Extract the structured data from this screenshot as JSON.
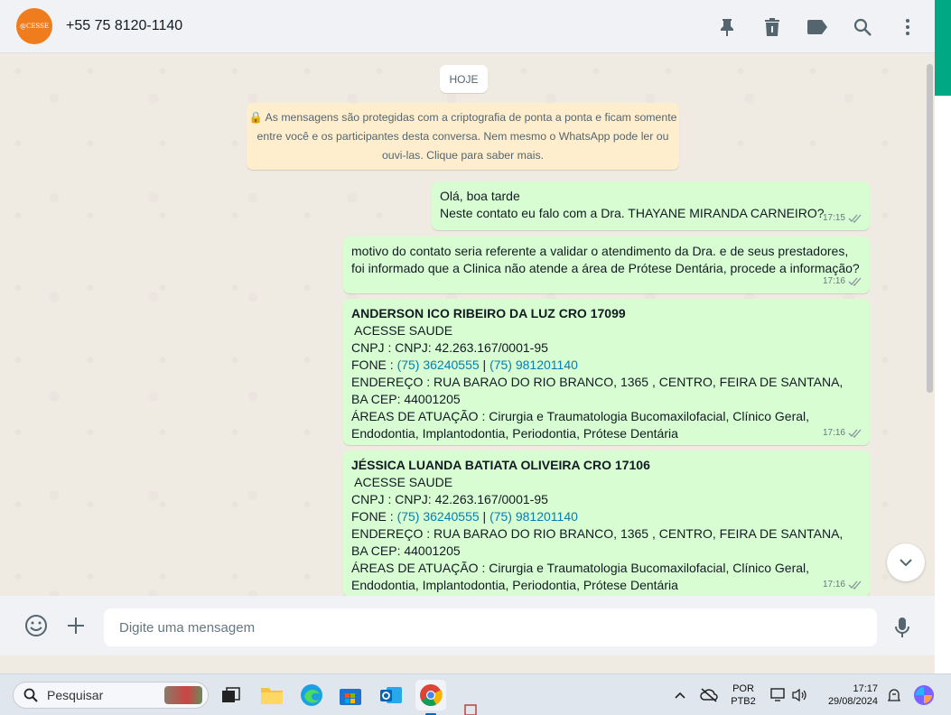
{
  "header": {
    "avatar_text": "@CESSE",
    "contact": "+55 75 8120-1140",
    "icons": [
      "pin-icon",
      "delete-icon",
      "label-icon",
      "search-icon",
      "menu-icon"
    ]
  },
  "chat": {
    "date_chip": "HOJE",
    "system_notice": "🔒 As mensagens são protegidas com a criptografia de ponta a ponta e ficam somente entre você e os participantes desta conversa. Nem mesmo o WhatsApp pode ler ou ouvi-las. Clique para saber mais.",
    "messages": [
      {
        "lines": [
          "Olá, boa tarde",
          "Neste contato eu falo com a Dra. THAYANE MIRANDA CARNEIRO?"
        ],
        "time": "17:15"
      },
      {
        "lines": [
          "motivo do contato seria referente a validar o atendimento da Dra. e de seus prestadores,",
          "foi informado que a Clinica não atende a área de Prótese Dentária, procede a informação?"
        ],
        "time": "17:16"
      },
      {
        "title": "ANDERSON ICO RIBEIRO DA LUZ  CRO 17099",
        "company": " ACESSE SAUDE",
        "cnpj": "CNPJ : CNPJ: 42.263.167/0001-95",
        "fone_label": "FONE : ",
        "phone1": "(75) 36240555",
        "sep": " | ",
        "phone2": "(75) 981201140",
        "address": "ENDEREÇO : RUA BARAO DO RIO BRANCO, 1365 , CENTRO, FEIRA DE SANTANA, BA CEP: 44001205",
        "areas": "ÁREAS DE ATUAÇÃO : Cirurgia e Traumatologia Bucomaxilofacial, Clínico Geral, Endodontia, Implantodontia, Periodontia, Prótese Dentária",
        "time": "17:16"
      },
      {
        "title": "JÉSSICA LUANDA BATIATA OLIVEIRA  CRO 17106",
        "company": " ACESSE SAUDE",
        "cnpj": "CNPJ : CNPJ: 42.263.167/0001-95",
        "fone_label": "FONE : ",
        "phone1": "(75) 36240555",
        "sep": " | ",
        "phone2": "(75) 981201140",
        "address": "ENDEREÇO : RUA BARAO DO RIO BRANCO, 1365 , CENTRO, FEIRA DE SANTANA, BA CEP: 44001205",
        "areas": "ÁREAS DE ATUAÇÃO : Cirurgia e Traumatologia Bucomaxilofacial, Clínico Geral, Endodontia, Implantodontia, Periodontia, Prótese Dentária",
        "time": "17:16"
      }
    ]
  },
  "composer": {
    "placeholder": "Digite uma mensagem"
  },
  "taskbar": {
    "search_label": "Pesquisar",
    "lang": "POR",
    "layout": "PTB2",
    "time": "17:17",
    "date": "29/08/2024"
  },
  "colors": {
    "bubble": "#d9fdd3",
    "accent": "#00a884",
    "notice": "#ffeecd"
  }
}
